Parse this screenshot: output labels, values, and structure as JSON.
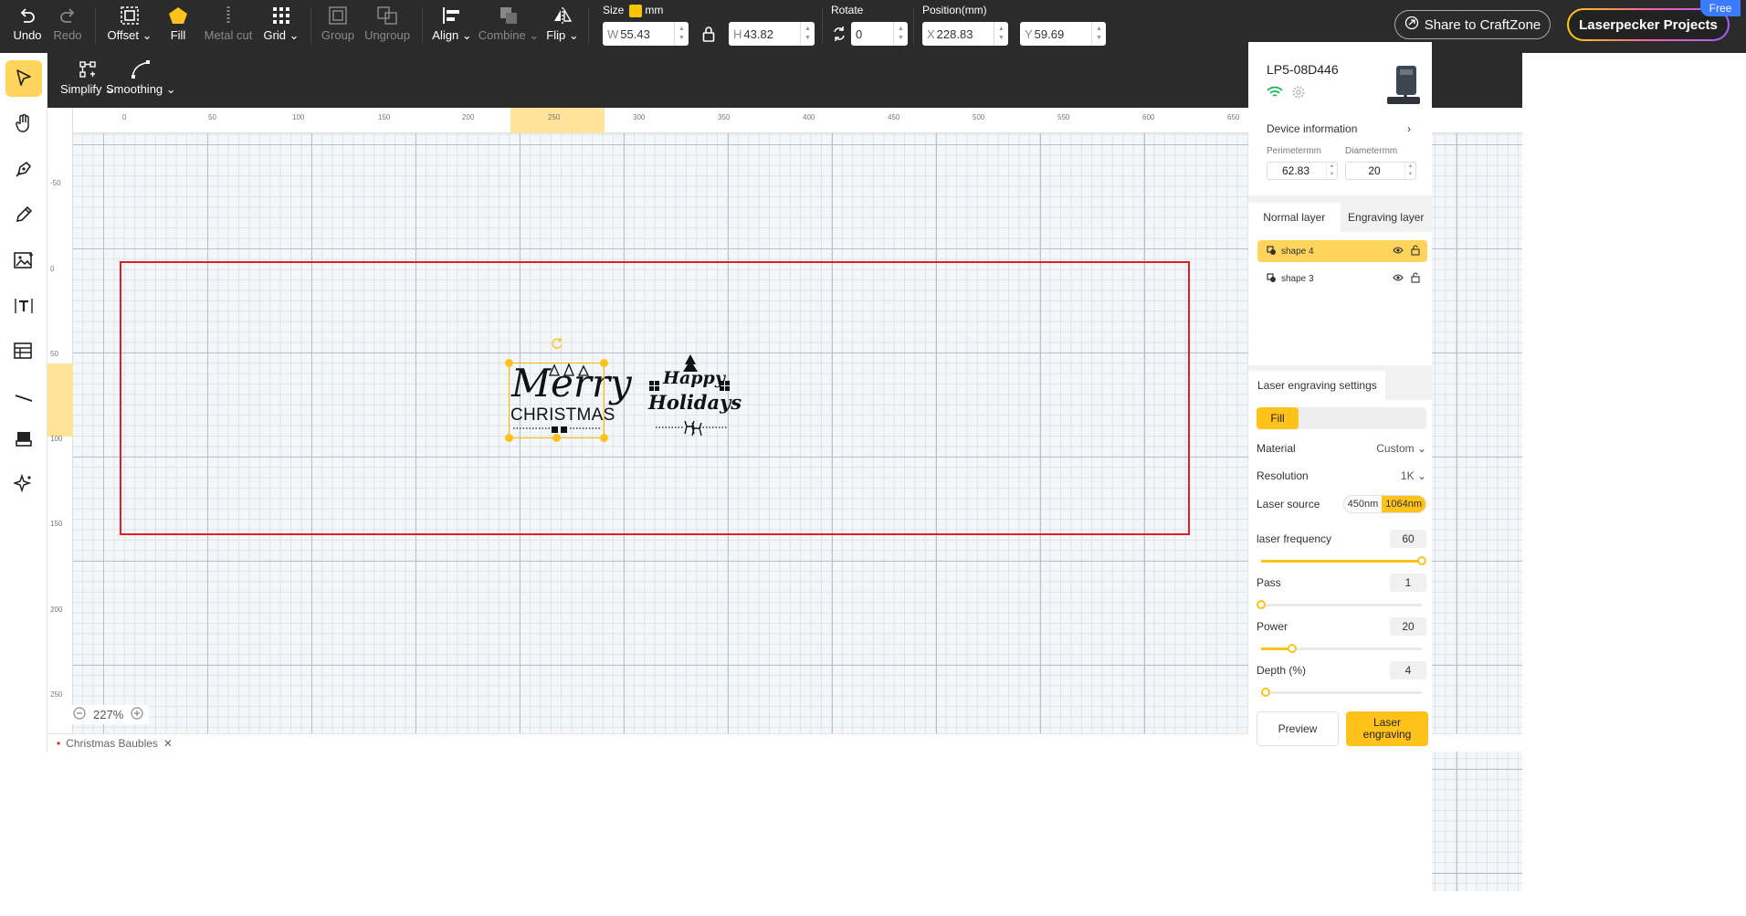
{
  "toolbar": {
    "undo": "Undo",
    "redo": "Redo",
    "offset": "Offset",
    "fill": "Fill",
    "metal_cut": "Metal cut",
    "grid": "Grid",
    "group": "Group",
    "ungroup": "Ungroup",
    "align": "Align",
    "combine": "Combine",
    "flip": "Flip",
    "size_label": "Size",
    "unit": "mm",
    "width_prefix": "W",
    "width": "55.43",
    "height_prefix": "H",
    "height": "43.82",
    "rotate_label": "Rotate",
    "rotate": "0",
    "position_label": "Position(mm)",
    "x_prefix": "X",
    "x": "228.83",
    "y_prefix": "Y",
    "y": "59.69",
    "share": "Share to CraftZone",
    "projects": "Laserpecker Projects",
    "free_badge": "Free"
  },
  "subtoolbar": {
    "simplify": "Simplify",
    "smoothing": "Smoothing"
  },
  "ruler": {
    "top": [
      "0",
      "50",
      "100",
      "150",
      "200",
      "250",
      "300",
      "350",
      "400",
      "450",
      "500",
      "550",
      "600",
      "650"
    ],
    "left": [
      "-50",
      "0",
      "50",
      "100",
      "150",
      "200",
      "250"
    ]
  },
  "canvas": {
    "zoom": "227%",
    "file_tab": "Christmas Baubles"
  },
  "designs": {
    "merry_1": "Merry",
    "merry_2": "CHRISTMAS",
    "happy_1": "Happy",
    "happy_2": "Holidays"
  },
  "device": {
    "name": "LP5-08D446",
    "info_label": "Device information",
    "perimeter_label": "Perimetermm",
    "perimeter": "62.83",
    "diameter_label": "Diametermm",
    "diameter": "20"
  },
  "layers": {
    "tab_normal": "Normal layer",
    "tab_engraving": "Engraving layer",
    "items": [
      {
        "name": "shape 4",
        "selected": true
      },
      {
        "name": "shape 3",
        "selected": false
      }
    ]
  },
  "engraving": {
    "title": "Laser engraving settings",
    "mode": "Fill",
    "material_label": "Material",
    "material": "Custom",
    "resolution_label": "Resolution",
    "resolution": "1K",
    "source_label": "Laser source",
    "source_a": "450nm",
    "source_b": "1064nm",
    "frequency_label": "laser frequency",
    "frequency": "60",
    "pass_label": "Pass",
    "pass": "1",
    "power_label": "Power",
    "power": "20",
    "depth_label": "Depth (%)",
    "depth": "4",
    "preview": "Preview",
    "engrave": "Laser engraving"
  },
  "colors": {
    "accent": "#ffc21a",
    "workarea": "#e02020",
    "toolbar": "#2b2b2b"
  }
}
